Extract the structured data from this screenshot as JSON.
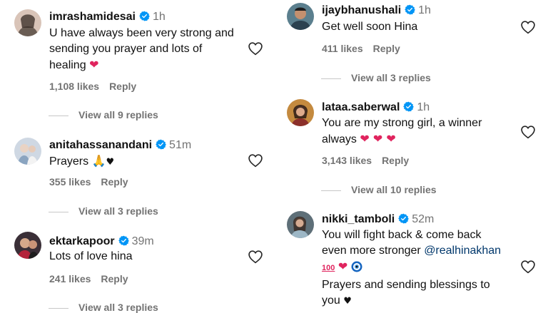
{
  "left_comments": [
    {
      "username": "imrashamidesai",
      "time": "1h",
      "lines": [
        "U have always been very strong and",
        "sending you prayer and lots of",
        "healing"
      ],
      "likes": "1,108 likes",
      "reply": "Reply",
      "view_replies": "View all 9 replies"
    },
    {
      "username": "anitahassanandani",
      "time": "51m",
      "text": "Prayers",
      "likes": "355 likes",
      "reply": "Reply",
      "view_replies": "View all 3 replies"
    },
    {
      "username": "ektarkapoor",
      "time": "39m",
      "text": "Lots of love hina",
      "likes": "241 likes",
      "reply": "Reply",
      "view_replies": "View all 3 replies"
    }
  ],
  "right_comments": [
    {
      "username": "ijaybhanushali",
      "time": "1h",
      "text": "Get well soon Hina",
      "likes": "411 likes",
      "reply": "Reply",
      "view_replies": "View all 3 replies"
    },
    {
      "username": "lataa.saberwal",
      "time": "1h",
      "lines": [
        "You are my strong girl, a winner",
        "always"
      ],
      "likes": "3,143 likes",
      "reply": "Reply",
      "view_replies": "View all 10 replies"
    },
    {
      "username": "nikki_tamboli",
      "time": "52m",
      "lines": [
        "You will fight back & come back",
        "even more stronger"
      ],
      "mention": "@realhinakhan",
      "lines2": [
        "Prayers and sending blessings to",
        "you"
      ]
    }
  ],
  "colors": {
    "verified": "#0095f6",
    "heart": "#e0245e",
    "muted": "#737373",
    "mention": "#00376b"
  }
}
